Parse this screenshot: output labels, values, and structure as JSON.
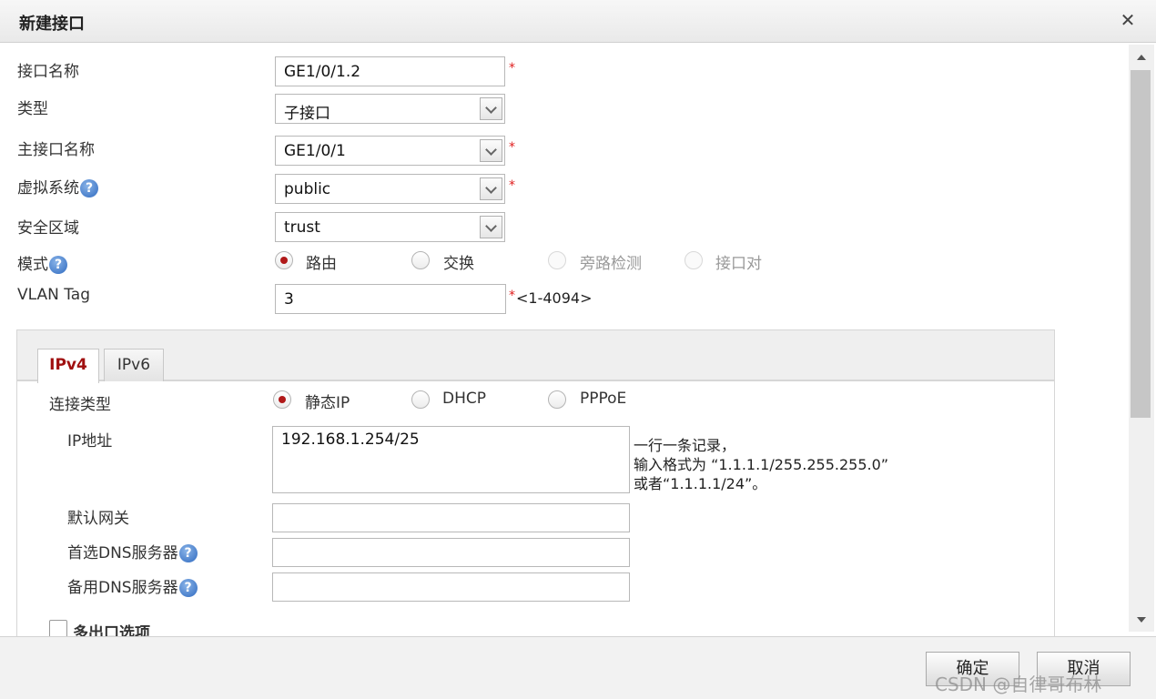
{
  "dialog": {
    "title": "新建接口",
    "close_glyph": "✕"
  },
  "form": {
    "interface_name": {
      "label": "接口名称",
      "value": "GE1/0/1.2",
      "required": "*"
    },
    "type": {
      "label": "类型",
      "value": "子接口"
    },
    "main_interface": {
      "label": "主接口名称",
      "value": "GE1/0/1",
      "required": "*"
    },
    "virtual_system": {
      "label": "虚拟系统",
      "value": "public",
      "required": "*"
    },
    "security_zone": {
      "label": "安全区域",
      "value": "trust"
    },
    "mode": {
      "label": "模式",
      "options": [
        {
          "label": "路由",
          "checked": true,
          "disabled": false
        },
        {
          "label": "交换",
          "checked": false,
          "disabled": false
        },
        {
          "label": "旁路检测",
          "checked": false,
          "disabled": true
        },
        {
          "label": "接口对",
          "checked": false,
          "disabled": true
        }
      ]
    },
    "vlan_tag": {
      "label": "VLAN Tag",
      "value": "3",
      "required": "*",
      "range_hint": "<1-4094>"
    }
  },
  "ip_panel": {
    "tabs": [
      {
        "label": "IPv4",
        "active": true
      },
      {
        "label": "IPv6",
        "active": false
      }
    ],
    "connection_type": {
      "label": "连接类型",
      "options": [
        {
          "label": "静态IP",
          "checked": true
        },
        {
          "label": "DHCP",
          "checked": false
        },
        {
          "label": "PPPoE",
          "checked": false
        }
      ]
    },
    "ip_address": {
      "label": "IP地址",
      "value": "192.168.1.254/25",
      "hint_lines": [
        "一行一条记录，",
        "输入格式为 “1.1.1.1/255.255.255.0”",
        "或者“1.1.1.1/24”。"
      ]
    },
    "default_gateway": {
      "label": "默认网关",
      "value": ""
    },
    "primary_dns": {
      "label": "首选DNS服务器",
      "value": ""
    },
    "backup_dns": {
      "label": "备用DNS服务器",
      "value": ""
    },
    "multi_exit": {
      "label": "多出口选项",
      "checked": false
    }
  },
  "help_glyph": "?",
  "footer": {
    "ok_label": "确定",
    "cancel_label": "取消",
    "watermark": "CSDN @自律哥布林"
  },
  "colors": {
    "accent_red": "#b01818",
    "required_red": "#e02020",
    "help_blue": "#2f6ac0"
  }
}
